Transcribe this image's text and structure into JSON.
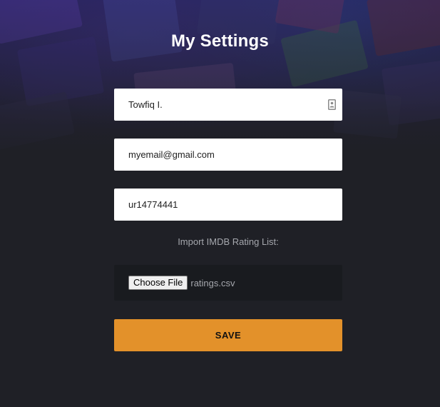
{
  "page": {
    "title": "My Settings",
    "background_color": "#1f2026",
    "accent_color": "#e3912a"
  },
  "form": {
    "name_field": {
      "value": "Towfiq I.",
      "icon": "contact-card-icon"
    },
    "email_field": {
      "value": "myemail@gmail.com"
    },
    "imdb_id_field": {
      "value": "ur14774441"
    },
    "import_label": "Import IMDB Rating List:",
    "file_input": {
      "button_label": "Choose File",
      "file_name": "ratings.csv"
    },
    "save_label": "SAVE"
  }
}
